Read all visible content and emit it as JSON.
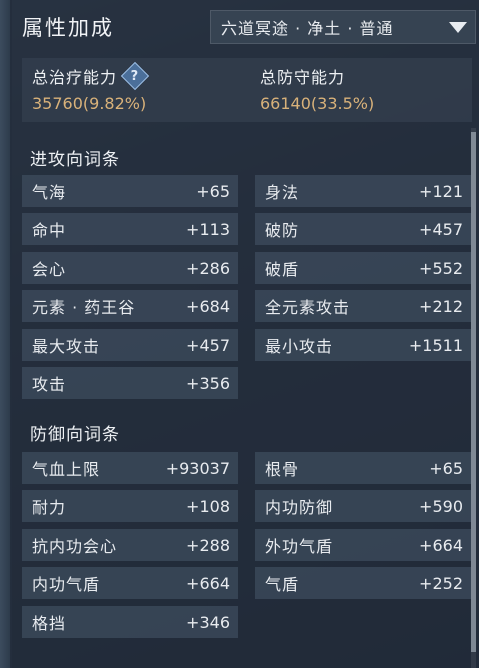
{
  "header": {
    "title": "属性加成",
    "dropdown_value": "六道冥途 · 净土 · 普通"
  },
  "summary": {
    "heal_label": "总治疗能力",
    "heal_value": "35760(9.82%)",
    "defense_label": "总防守能力",
    "defense_value": "66140(33.5%)",
    "help_glyph": "?"
  },
  "attack": {
    "title": "进攻向词条",
    "items": [
      {
        "name": "气海",
        "value": "+65"
      },
      {
        "name": "身法",
        "value": "+121"
      },
      {
        "name": "命中",
        "value": "+113"
      },
      {
        "name": "破防",
        "value": "+457"
      },
      {
        "name": "会心",
        "value": "+286"
      },
      {
        "name": "破盾",
        "value": "+552"
      },
      {
        "name": "元素 · 药王谷",
        "value": "+684"
      },
      {
        "name": "全元素攻击",
        "value": "+212"
      },
      {
        "name": "最大攻击",
        "value": "+457"
      },
      {
        "name": "最小攻击",
        "value": "+1511"
      },
      {
        "name": "攻击",
        "value": "+356"
      }
    ]
  },
  "defense": {
    "title": "防御向词条",
    "items": [
      {
        "name": "气血上限",
        "value": "+93037"
      },
      {
        "name": "根骨",
        "value": "+65"
      },
      {
        "name": "耐力",
        "value": "+108"
      },
      {
        "name": "内功防御",
        "value": "+590"
      },
      {
        "name": "抗内功会心",
        "value": "+288"
      },
      {
        "name": "外功气盾",
        "value": "+664"
      },
      {
        "name": "内功气盾",
        "value": "+664"
      },
      {
        "name": "气盾",
        "value": "+252"
      },
      {
        "name": "格挡",
        "value": "+346"
      }
    ]
  },
  "colors": {
    "value_gold": "#d9b27a",
    "panel_bg": "#222c3a"
  }
}
